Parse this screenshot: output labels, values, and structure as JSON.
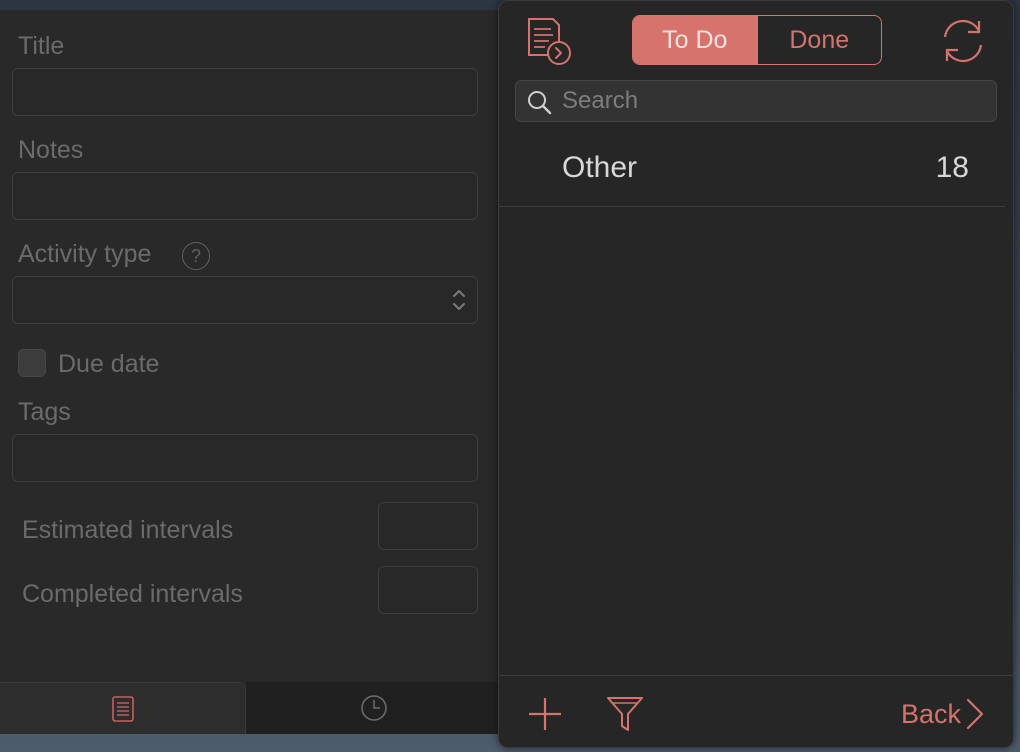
{
  "editor": {
    "title_label": "Title",
    "title_value": "",
    "notes_label": "Notes",
    "notes_value": "",
    "activity_type_label": "Activity type",
    "activity_type_help": "?",
    "activity_type_value": "",
    "due_date_label": "Due date",
    "due_date_checked": false,
    "tags_label": "Tags",
    "tags_value": "",
    "estimated_intervals_label": "Estimated intervals",
    "estimated_intervals_value": "",
    "completed_intervals_label": "Completed intervals",
    "completed_intervals_value": "",
    "tabs": [
      {
        "name": "notes",
        "icon": "document-icon"
      },
      {
        "name": "history",
        "icon": "clock-icon"
      }
    ]
  },
  "tasks": {
    "toolbar": {
      "doc_icon": "document-arrow-icon",
      "segment_todo": "To Do",
      "segment_done": "Done",
      "active_segment": "todo",
      "sync_icon": "sync-icon"
    },
    "search": {
      "placeholder": "Search",
      "value": ""
    },
    "groups": [
      {
        "label": "Other",
        "count": "18"
      }
    ],
    "bottom": {
      "add_icon": "plus-icon",
      "filter_icon": "funnel-icon",
      "back_label": "Back"
    }
  },
  "colors": {
    "accent": "#d5736c",
    "panel_bg": "#262626",
    "editor_bg": "#292929",
    "muted_text": "#6b6b6b"
  }
}
